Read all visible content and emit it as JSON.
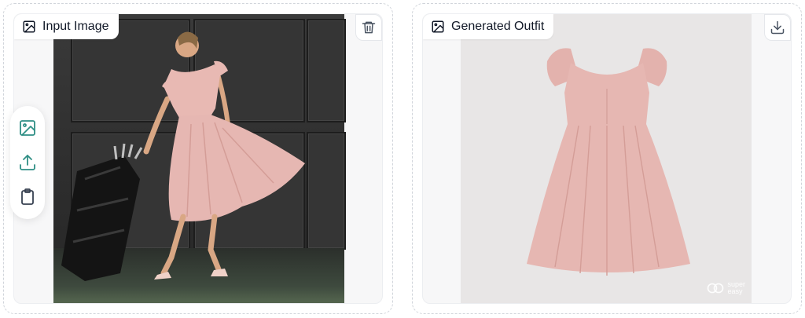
{
  "input_panel": {
    "label": "Input Image",
    "icons": {
      "tag": "image-icon",
      "action": "trash-icon"
    }
  },
  "output_panel": {
    "label": "Generated Outfit",
    "icons": {
      "tag": "image-icon",
      "action": "download-icon"
    },
    "watermark": {
      "line1": "super",
      "line2": "easy"
    }
  },
  "toolbar": {
    "items": [
      {
        "name": "gallery",
        "icon": "image-icon"
      },
      {
        "name": "upload",
        "icon": "upload-icon"
      },
      {
        "name": "paste",
        "icon": "clipboard-icon"
      }
    ]
  },
  "colors": {
    "accent_teal": "#2f8f85",
    "dress_pink": "#e6b7b2",
    "wall_dark": "#333333",
    "product_bg": "#e8e6e6"
  }
}
